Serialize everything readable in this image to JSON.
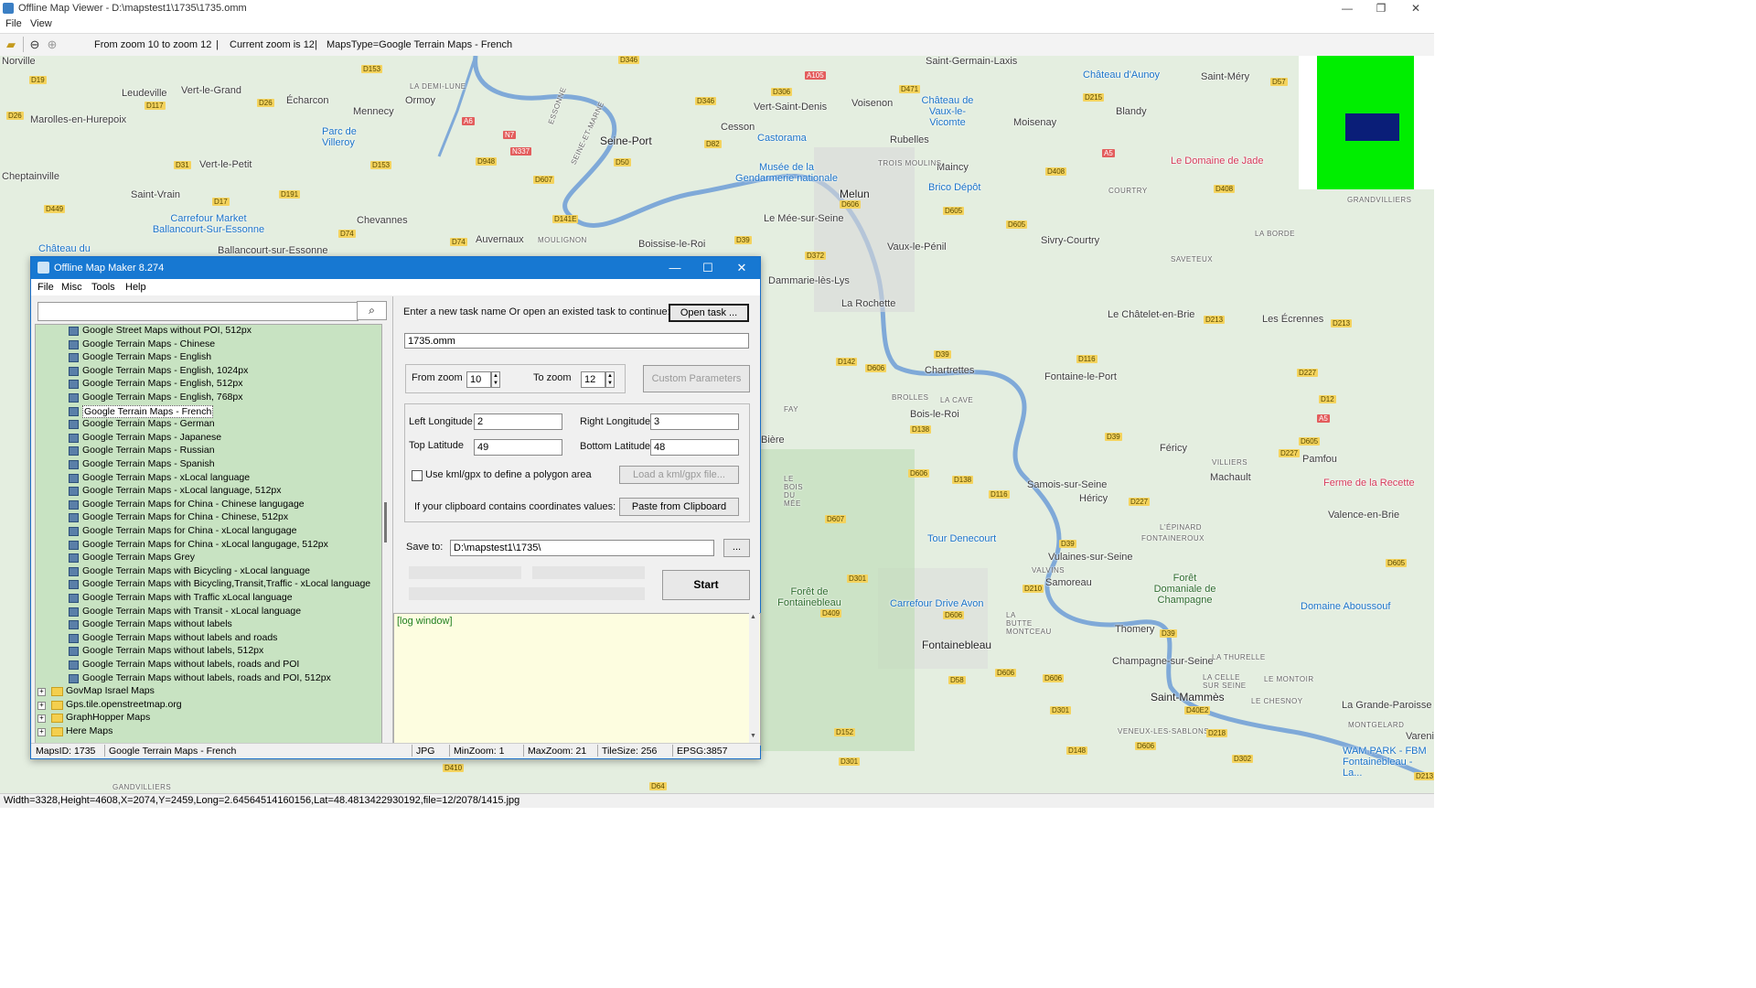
{
  "window": {
    "title": "Offline Map Viewer - D:\\mapstest1\\1735\\1735.omm",
    "controls": {
      "minimize": "—",
      "maximize": "❐",
      "close": "✕"
    }
  },
  "menubar": {
    "file": "File",
    "view": "View"
  },
  "toolbar": {
    "zoom_range": "From zoom 10 to zoom 12",
    "sep1": "|",
    "current_zoom": "Current zoom is 12",
    "sep2": "|",
    "maps_type": "MapsType=Google Terrain Maps - French"
  },
  "map": {
    "places": [
      "Norville",
      "Leudeville",
      "Vert-le-Grand",
      "Écharcon",
      "Ormoy",
      "Mennecy",
      "Marolles-en-Hurepoix",
      "Parc de Villeroy",
      "Cheptainville",
      "Vert-le-Petit",
      "Saint-Vrain",
      "Chevannes",
      "Ballancourt-sur-Essonne",
      "Auvernaux",
      "Boissise-le-Roi",
      "Seine-Port",
      "Cesson",
      "Vert-Saint-Denis",
      "Voisenon",
      "Saint-Germain-Laxis",
      "Moisenay",
      "Blandy",
      "Saint-Méry",
      "Rubelles",
      "Maincy",
      "Melun",
      "Le Mée-sur-Seine",
      "Vaux-le-Pénil",
      "Dammarie-lès-Lys",
      "La Rochette",
      "Sivry-Courtry",
      "Le Châtelet-en-Brie",
      "Les Écrennes",
      "Chartrettes",
      "Fontaine-le-Port",
      "Bois-le-Roi",
      "Féricy",
      "Pamfou",
      "Machault",
      "Samois-sur-Seine",
      "Héricy",
      "Valence-en-Brie",
      "Vulaines-sur-Seine",
      "Samoreau",
      "Fontainebleau",
      "Thomery",
      "Champagne-sur-Seine",
      "Saint-Mammès",
      "La Grande-Paroisse",
      "Vareni",
      "Bière",
      "Bière"
    ],
    "pois": [
      "Carrefour Market Ballancourt-Sur-Essonne",
      "Château du",
      "Castorama",
      "Musée de la Gendarmerie nationale",
      "Brico Dépôt",
      "Château de Vaux-le-Vicomte",
      "Château d'Aunoy",
      "Tour Denecourt",
      "Carrefour Drive Avon",
      "Forêt de Fontainebleau",
      "Forêt Domaniale de Champagne",
      "Domaine Aboussouf",
      "WAM PARK - FBM Fontainebleau - La..."
    ],
    "pois_red": [
      "Le Domaine de Jade",
      "Ferme de la Recette"
    ],
    "small_labels": [
      "TROIS MOULINS",
      "COURTRY",
      "LA BORDE",
      "SAVETEUX",
      "BROLLES",
      "LA CAVE",
      "FAY",
      "LE BOIS DU MÉE",
      "L'ÉPINARD",
      "FONTAINEROUX",
      "VALVINS",
      "LA BUTTE MONTCEAU",
      "LA THURELLE",
      "LA CELLE SUR SEINE",
      "LE MONTOIR",
      "LE CHESNOY",
      "MONTGELARD",
      "VENEUX-LES-SABLONS",
      "GRANDVILLIERS",
      "VILLIERS",
      "MOULIGNON",
      "LA DEMI-LUNE",
      "ESSONNE",
      "SEINE-ET-MARNE",
      "GANDVILLIERS"
    ],
    "roads": [
      "D19",
      "D153",
      "D346",
      "A105",
      "D306",
      "D471",
      "D215",
      "D57",
      "D26",
      "D117",
      "D26",
      "D346",
      "D82",
      "A6",
      "N7",
      "N337",
      "D948",
      "D50",
      "D607",
      "D31",
      "D153",
      "D191",
      "D17",
      "D449",
      "D74",
      "D141E",
      "D74",
      "D39",
      "D606",
      "D372",
      "D408",
      "A5",
      "D408",
      "D605",
      "D605",
      "D39",
      "D142",
      "D606",
      "D116",
      "D213",
      "D227",
      "D12",
      "D213",
      "D605",
      "D39",
      "D138",
      "D605",
      "D227",
      "D606",
      "D138",
      "D116",
      "D227",
      "D607",
      "D39",
      "D301",
      "D409",
      "D210",
      "D39",
      "D606",
      "D606",
      "D58",
      "D606",
      "D301",
      "D152",
      "D148",
      "D606",
      "D218",
      "D40E2",
      "D301",
      "D302",
      "D605",
      "D64",
      "D410",
      "D213"
    ],
    "roads_red": [
      "A105",
      "A6",
      "A5",
      "A5"
    ]
  },
  "statusbar": {
    "text": "Width=3328,Height=4608,X=2074,Y=2459,Long=2.64564514160156,Lat=48.4813422930192,file=12/2078/1415.jpg"
  },
  "dialog": {
    "title": "Offline Map Maker 8.274",
    "controls": {
      "minimize": "—",
      "maximize": "☐",
      "close": "✕"
    },
    "menu": {
      "file": "File",
      "misc": "Misc",
      "tools": "Tools",
      "help": "Help"
    },
    "search": {
      "placeholder": "",
      "button_icon": "⌕"
    },
    "tree": {
      "children": [
        "Google Street Maps without POI, 512px",
        "Google Terrain Maps - Chinese",
        "Google Terrain Maps - English",
        "Google Terrain Maps - English, 1024px",
        "Google Terrain Maps - English, 512px",
        "Google Terrain Maps - English, 768px",
        "Google Terrain Maps - French",
        "Google Terrain Maps - German",
        "Google Terrain Maps - Japanese",
        "Google Terrain Maps - Russian",
        "Google Terrain Maps - Spanish",
        "Google Terrain Maps - xLocal language",
        "Google Terrain Maps - xLocal language, 512px",
        "Google Terrain Maps for China - Chinese langugage",
        "Google Terrain Maps for China - Chinese, 512px",
        "Google Terrain Maps for China - xLocal langugage",
        "Google Terrain Maps for China - xLocal langugage, 512px",
        "Google Terrain Maps Grey",
        "Google Terrain Maps with Bicycling - xLocal language",
        "Google Terrain Maps with Bicycling,Transit,Traffic - xLocal language",
        "Google Terrain Maps with Traffic xLocal language",
        "Google Terrain Maps with Transit - xLocal language",
        "Google Terrain Maps without labels",
        "Google Terrain Maps without labels and roads",
        "Google Terrain Maps without labels, 512px",
        "Google Terrain Maps without labels, roads and POI",
        "Google Terrain Maps without labels, roads and POI, 512px"
      ],
      "selected": "Google Terrain Maps - French",
      "folders": [
        "GovMap Israel Maps",
        "Gps.tile.openstreetmap.org",
        "GraphHopper Maps",
        "Here Maps"
      ],
      "expander": "+"
    },
    "task": {
      "prompt": "Enter a new task name Or open an existed task to continue:",
      "open_button": "Open task ...",
      "name_value": "1735.omm"
    },
    "zoom": {
      "from_label": "From zoom",
      "from_value": "10",
      "to_label": "To zoom",
      "to_value": "12",
      "custom_button": "Custom Parameters",
      "up": "▲",
      "down": "▼"
    },
    "coords": {
      "left_lon_label": "Left Longitude",
      "left_lon_value": "2",
      "right_lon_label": "Right Longitude",
      "right_lon_value": "3",
      "top_lat_label": "Top Latitude",
      "top_lat_value": "49",
      "bottom_lat_label": "Bottom Latitude",
      "bottom_lat_value": "48",
      "kml_checkbox_label": "Use kml/gpx to define a polygon area",
      "kml_checked": false,
      "load_kml_button": "Load a kml/gpx file...",
      "clipboard_label": "If your clipboard contains coordinates values:",
      "paste_button": "Paste from Clipboard"
    },
    "save": {
      "label": "Save to:",
      "value": "D:\\mapstest1\\1735\\",
      "browse_button": "..."
    },
    "start_button": "Start",
    "log": {
      "text": "[log window]",
      "scroll_up": "▲",
      "scroll_down": "▼"
    },
    "status": {
      "maps_id": "MapsID: 1735",
      "maps_name": "Google Terrain Maps - French",
      "format": "JPG",
      "min_zoom": "MinZoom: 1",
      "max_zoom": "MaxZoom: 21",
      "tile_size": "TileSize: 256",
      "epsg": "EPSG:3857"
    }
  },
  "colors": {
    "map_bg": "#e4eee0",
    "water": "#7fa9d8",
    "dialog_title": "#1778d2",
    "tree_bg": "#c8e3c2",
    "log_bg": "#fdfde0",
    "minimap_green": "#00ee00",
    "minimap_view": "#0a1e78"
  }
}
